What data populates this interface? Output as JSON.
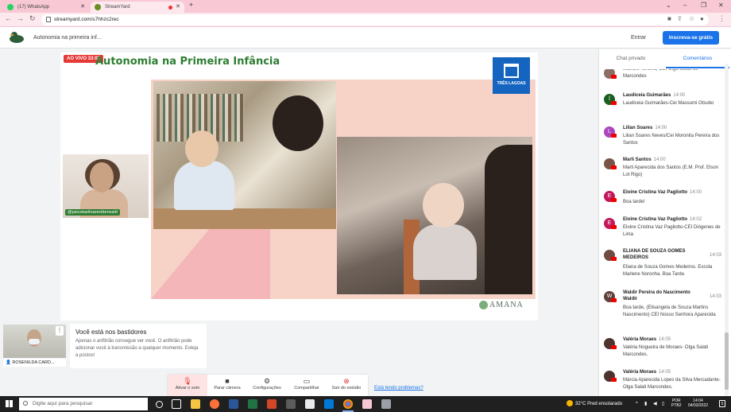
{
  "browser": {
    "tabs": [
      {
        "title": "(17) WhatsApp",
        "color": "#25d366"
      },
      {
        "title": "StreamYard",
        "color": "#6b8e23"
      }
    ],
    "url": "streamyard.com/s7hhzc2rec"
  },
  "header": {
    "broadcast_title": "Autonomia na primeira inf...",
    "login_label": "Entrar",
    "signup_label": "Inscreva-se grátis"
  },
  "stage": {
    "live_badge": "AO VIVO 33:05",
    "slide_title": "Autonomia na Primeira Infância",
    "slide_logo_text": "TRÊS LAGOAS",
    "watermark": "AMANA",
    "camera_tag": "@psicokarlinarecktenvald"
  },
  "backstage": {
    "participant_name": "ROSENILDA CARD...",
    "title": "Você está nos bastidores",
    "message": "Apenas o anfitrião consegue ver você. O anfitrião pode adicionar você à transmissão a qualquer momento. Esteja a postos!"
  },
  "controls": {
    "mute": "Ativar o som",
    "camera": "Parar câmera",
    "settings": "Configurações",
    "share": "Compartilhar",
    "leave": "Sair do estúdio",
    "problems_link": "Está tendo problemas?"
  },
  "panel": {
    "tab_chat": "Chat privado",
    "tab_comments": "Comentários",
    "comments": [
      {
        "name": "",
        "time": "",
        "text": "Michele Tenório, CEI Olga Salati de Marcondes",
        "initial": "",
        "color": "#8d6e63"
      },
      {
        "name": "Laudiceia Guimarães",
        "time": "14:00",
        "text": "Laudiceia Guimarães-Cei Massumi Otsubo",
        "initial": "l",
        "color": "#1b5e20"
      },
      {
        "name": "Lilian Soares",
        "time": "14:00",
        "text": "Lilian Soares Neves/Cei Moronita Pereira dos Santos",
        "initial": "L",
        "color": "#ab47bc"
      },
      {
        "name": "Marli Santos",
        "time": "14:00",
        "text": "Marli Aparecida dos Santos (E.M. Prof. Elson Lot Rigo)",
        "initial": "",
        "color": "#795548"
      },
      {
        "name": "Eloine Cristina Vaz Pagliotto",
        "time": "14:00",
        "text": "Boa tarde!",
        "initial": "E",
        "color": "#c2185b"
      },
      {
        "name": "Eloine Cristina Vaz Pagliotto",
        "time": "14:02",
        "text": "Eloine Cristina Vaz Pagliotto-CEI Diógenes de Lima",
        "initial": "E",
        "color": "#c2185b"
      },
      {
        "name": "ELIANA DE SOUZA GOMES MEDEIROS",
        "time": "14:03",
        "text": "Eliana de Souza Gomes Medeiros. Escola Marlene Noronha. Boa Tarde.",
        "initial": "",
        "color": "#6d4c41"
      },
      {
        "name": "Waldir Pereira do Nascimento Waldir",
        "time": "14:03",
        "text": "Boa tarde, (Elisangela de Souza Martins Nascimento) CEI Nosso Senhora Aparecida",
        "initial": "W",
        "color": "#5d4037"
      },
      {
        "name": "Valéria Moraes",
        "time": "14:05",
        "text": "Valéria Nogueira de Moraes- Olga Salati Marcondes.",
        "initial": "",
        "color": "#4e342e"
      },
      {
        "name": "Valéria Moraes",
        "time": "14:05",
        "text": "Márcia Aparecida Lopes da Silva Mercadante- Olga Salati Marcondes.",
        "initial": "",
        "color": "#4e342e"
      }
    ]
  },
  "taskbar": {
    "search_placeholder": "Digite aqui para pesquisar",
    "weather": "32°C  Pred ensolarado",
    "lang_line1": "POR",
    "lang_line2": "PTB2",
    "time": "14:04",
    "date": "04/03/2022",
    "notifications": "5"
  }
}
